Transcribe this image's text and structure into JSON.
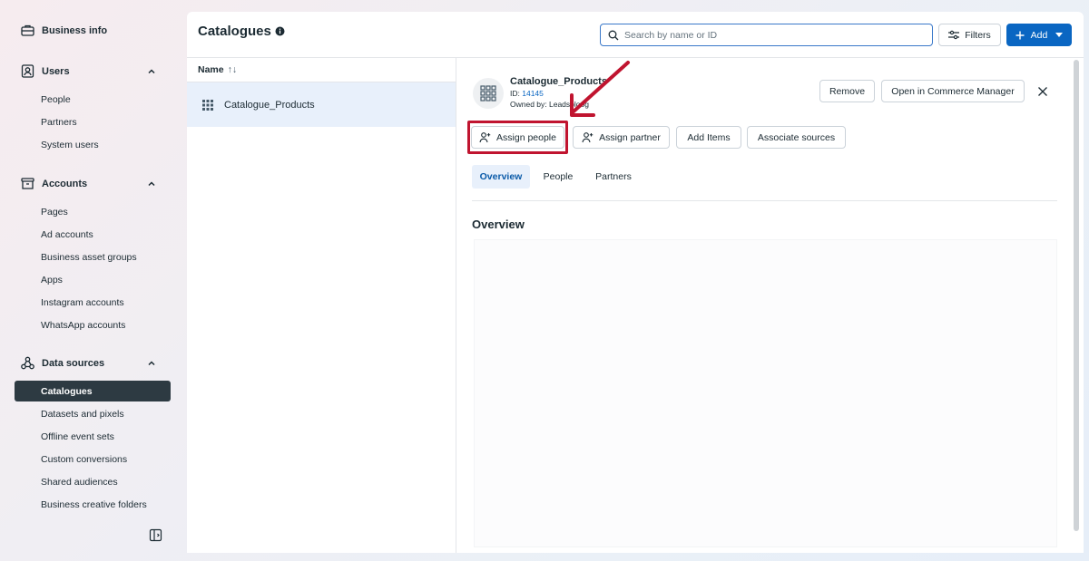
{
  "sidebar": {
    "business_info": "Business info",
    "users": {
      "header": "Users",
      "items": [
        "People",
        "Partners",
        "System users"
      ]
    },
    "accounts": {
      "header": "Accounts",
      "items": [
        "Pages",
        "Ad accounts",
        "Business asset groups",
        "Apps",
        "Instagram accounts",
        "WhatsApp accounts"
      ]
    },
    "data_sources": {
      "header": "Data sources",
      "active": "Catalogues",
      "items": [
        "Datasets and pixels",
        "Offline event sets",
        "Custom conversions",
        "Shared audiences",
        "Business creative folders"
      ]
    }
  },
  "header": {
    "title": "Catalogues",
    "search_placeholder": "Search by name or ID",
    "filters_label": "Filters",
    "add_label": "Add"
  },
  "list": {
    "column_name": "Name",
    "sort_glyph": "↑↓",
    "rows": [
      "Catalogue_Products"
    ]
  },
  "detail": {
    "name": "Catalogue_Products",
    "id_prefix": "ID: ",
    "id_value": "14145",
    "owned_by": "Owned by: Leadsbloog",
    "remove_label": "Remove",
    "open_commerce_label": "Open in Commerce Manager",
    "actions": {
      "assign_people": "Assign people",
      "assign_partner": "Assign partner",
      "add_items": "Add Items",
      "associate_sources": "Associate sources"
    },
    "tabs": [
      "Overview",
      "People",
      "Partners"
    ],
    "active_tab": "Overview",
    "section_title": "Overview"
  },
  "colors": {
    "accent": "#0a66c2",
    "highlight": "#c0142f",
    "active_nav": "#2d3a42"
  }
}
